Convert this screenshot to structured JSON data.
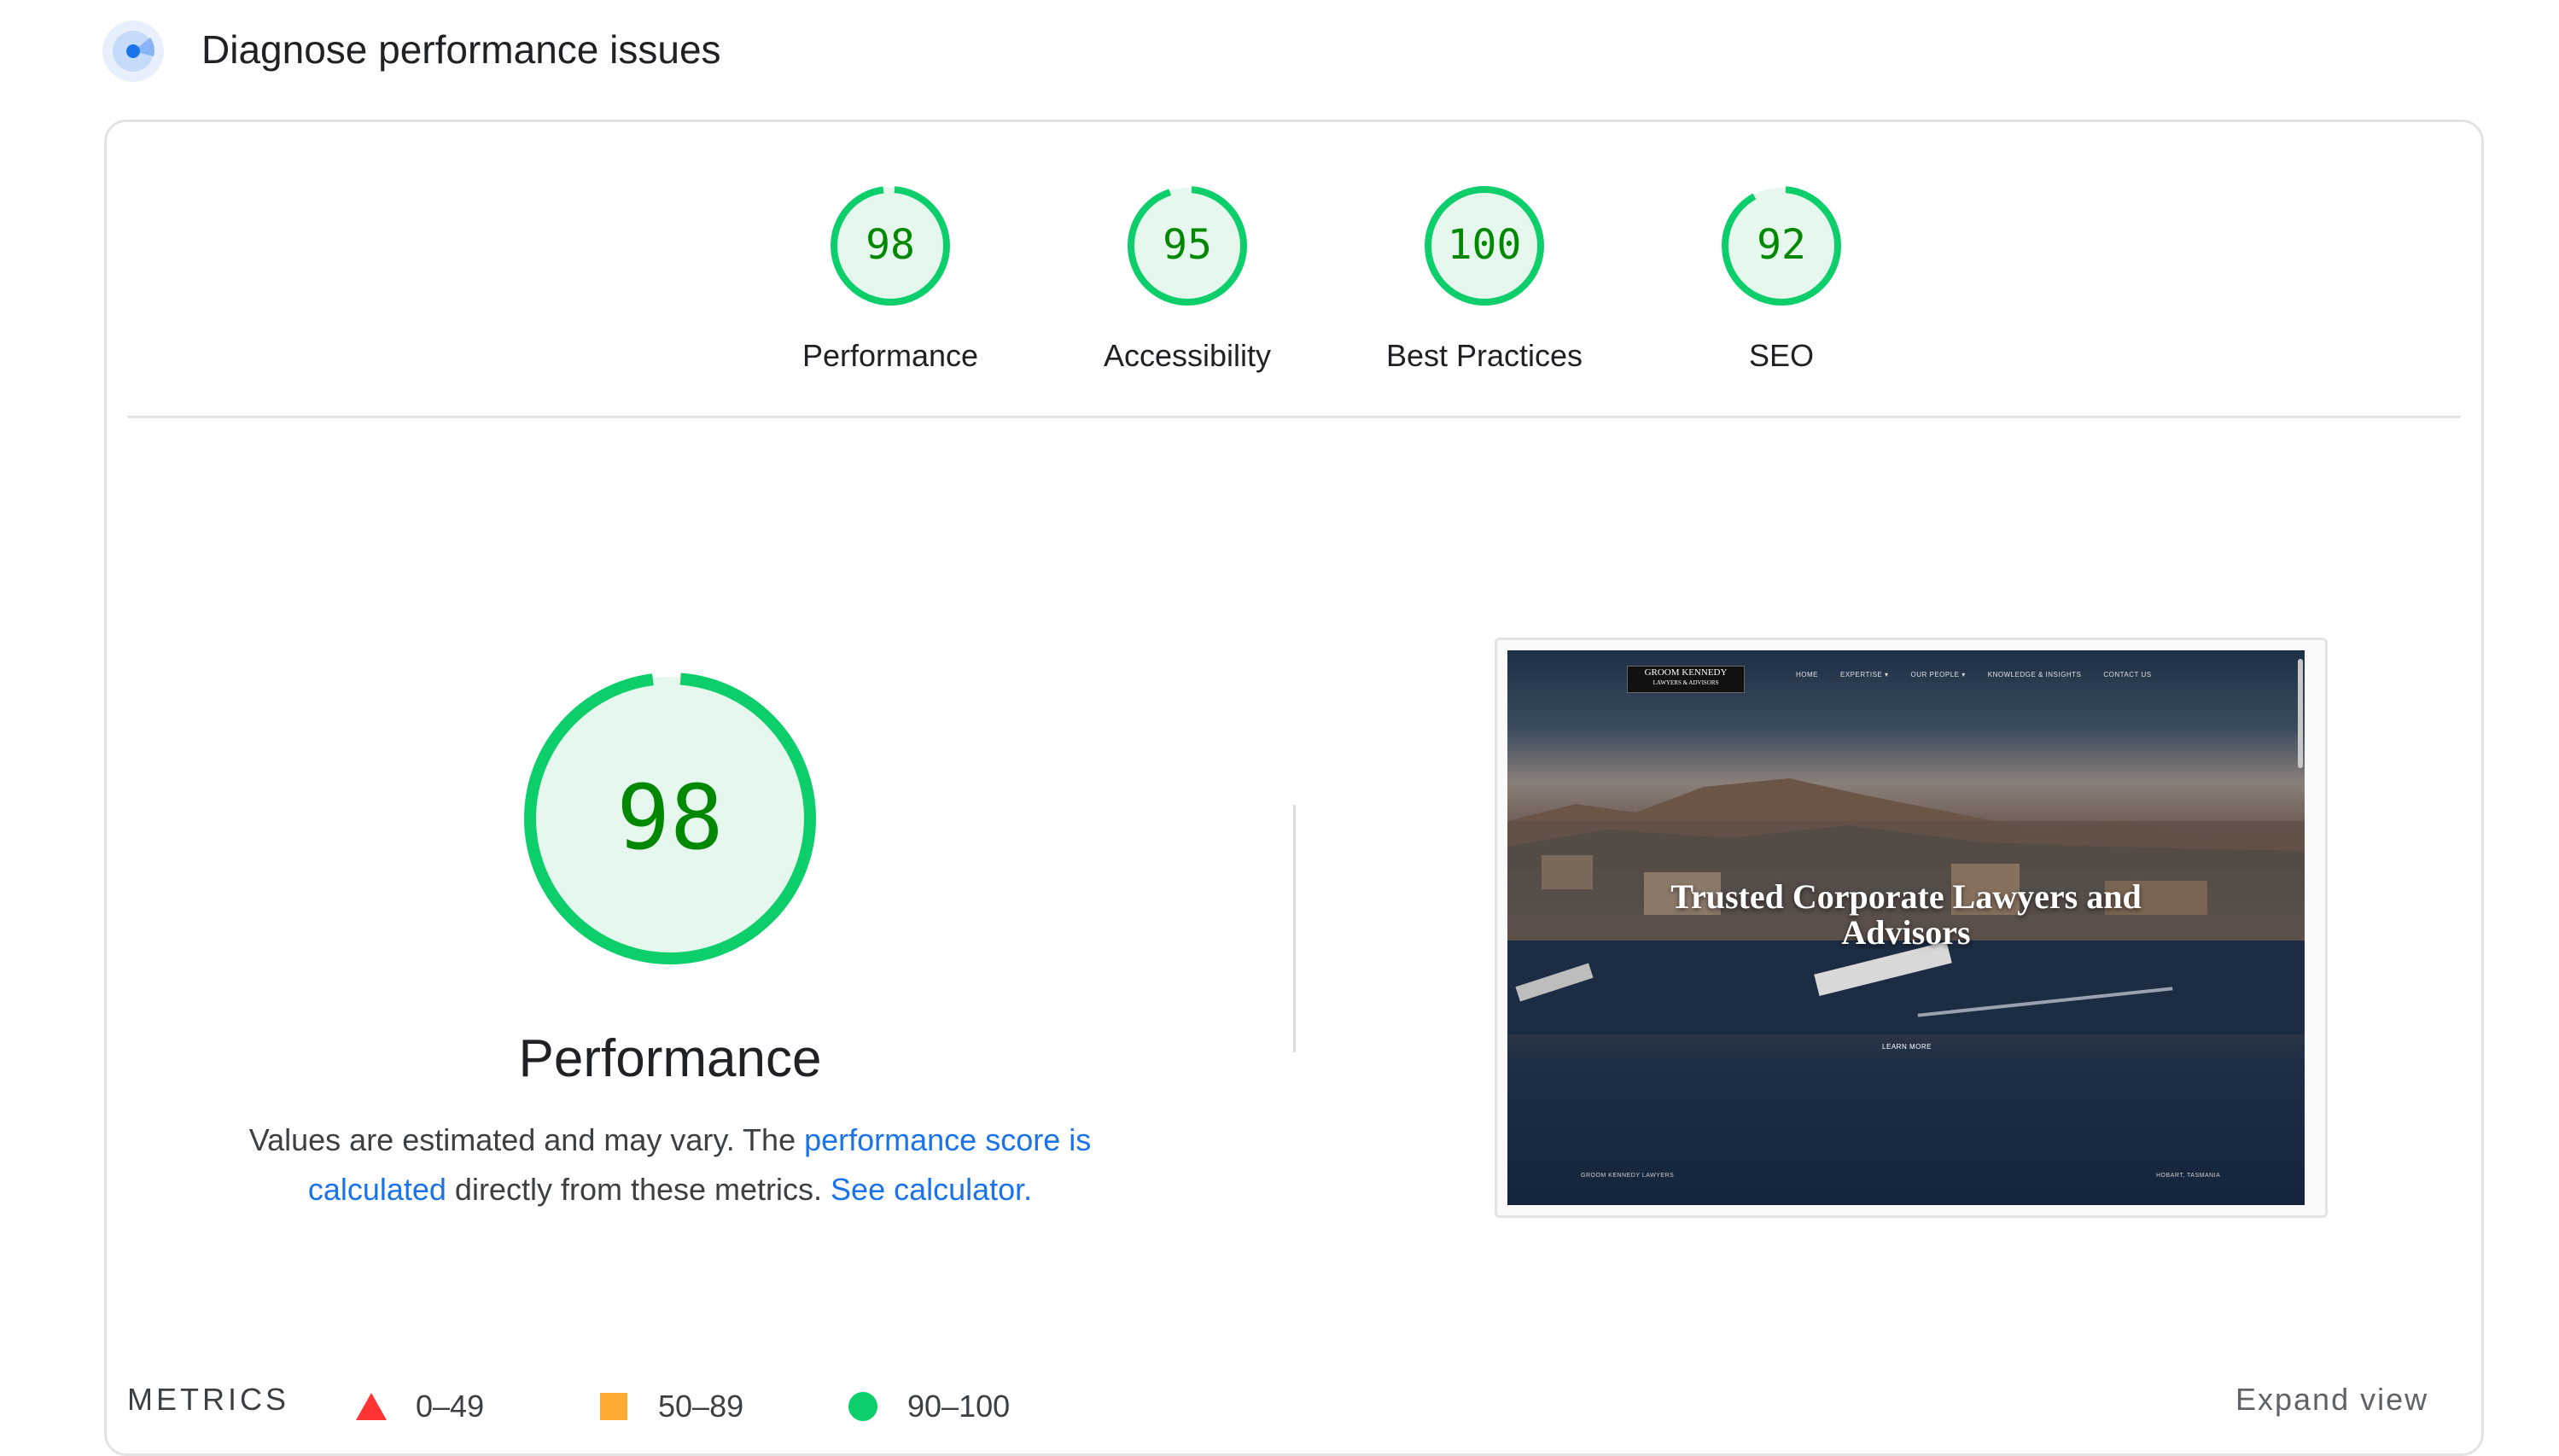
{
  "header": {
    "title": "Diagnose performance issues",
    "icon": "lighthouse-icon"
  },
  "categories": [
    {
      "score": "98",
      "label": "Performance",
      "value": 0.98
    },
    {
      "score": "95",
      "label": "Accessibility",
      "value": 0.95
    },
    {
      "score": "100",
      "label": "Best Practices",
      "value": 1.0
    },
    {
      "score": "92",
      "label": "SEO",
      "value": 0.92
    }
  ],
  "main": {
    "score": "98",
    "value": 0.98,
    "title": "Performance",
    "desc_part1": "Values are estimated and may vary. The ",
    "desc_link1": "performance score is calculated",
    "desc_part2": " directly from these metrics. ",
    "desc_link2": "See calculator."
  },
  "legend": [
    {
      "range": "0–49",
      "shape": "triangle",
      "color": "#f33"
    },
    {
      "range": "50–89",
      "shape": "square",
      "color": "#ffaa33"
    },
    {
      "range": "90–100",
      "shape": "circle",
      "color": "#0cce6b"
    }
  ],
  "screenshot": {
    "logo": "GROOM KENNEDY",
    "logo_sub": "LAWYERS & ADVISORS",
    "nav": [
      "HOME",
      "EXPERTISE ▾",
      "OUR PEOPLE ▾",
      "KNOWLEDGE & INSIGHTS",
      "CONTACT US"
    ],
    "hero": "Trusted Corporate Lawyers and Advisors",
    "cta": "LEARN MORE",
    "footer_left": "GROOM KENNEDY LAWYERS",
    "footer_right": "HOBART, TASMANIA"
  },
  "metrics": {
    "label": "METRICS",
    "expand": "Expand view"
  },
  "colors": {
    "pass": "#0cce6b",
    "pass_bg": "#e6f7ee",
    "pass_text": "#008800",
    "link": "#1a73e8"
  }
}
